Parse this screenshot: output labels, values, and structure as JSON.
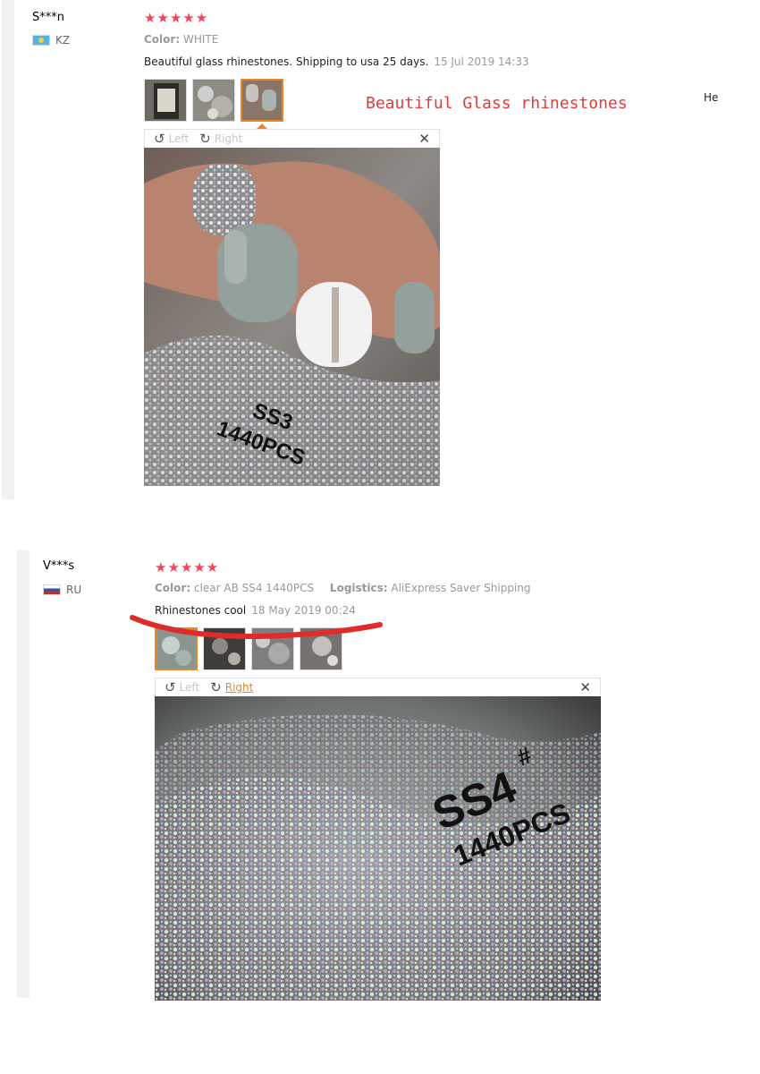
{
  "reviews": [
    {
      "user": "S***n",
      "country": "KZ",
      "stars": "★★★★★",
      "attributes": [
        {
          "label": "Color:",
          "value": "WHITE"
        }
      ],
      "text": "Beautiful glass rhinestones. Shipping to usa 25 days.",
      "date": "15 Jul 2019 14:33",
      "viewer": {
        "left": "Left",
        "right": "Right",
        "close": "✕"
      },
      "photo_labels": {
        "size": "SS3",
        "count": "1440PCS"
      }
    },
    {
      "user": "V***s",
      "country": "RU",
      "stars": "★★★★★",
      "attributes": [
        {
          "label": "Color:",
          "value": "clear AB SS4 1440PCS"
        },
        {
          "label": "Logistics:",
          "value": "AliExpress Saver Shipping"
        }
      ],
      "text": "Rhinestones cool",
      "date": "18 May 2019 00:24",
      "viewer": {
        "left": "Left",
        "right": "Right",
        "close": "✕"
      },
      "photo_labels": {
        "size": "SS4",
        "hash": "#",
        "count": "1440PCS"
      }
    }
  ],
  "overlay_caption": "Beautiful Glass rhinestones",
  "side_note": "He",
  "colors": {
    "star": "#f2455a",
    "accent": "#e8862a",
    "annotation": "#e23b3b"
  }
}
